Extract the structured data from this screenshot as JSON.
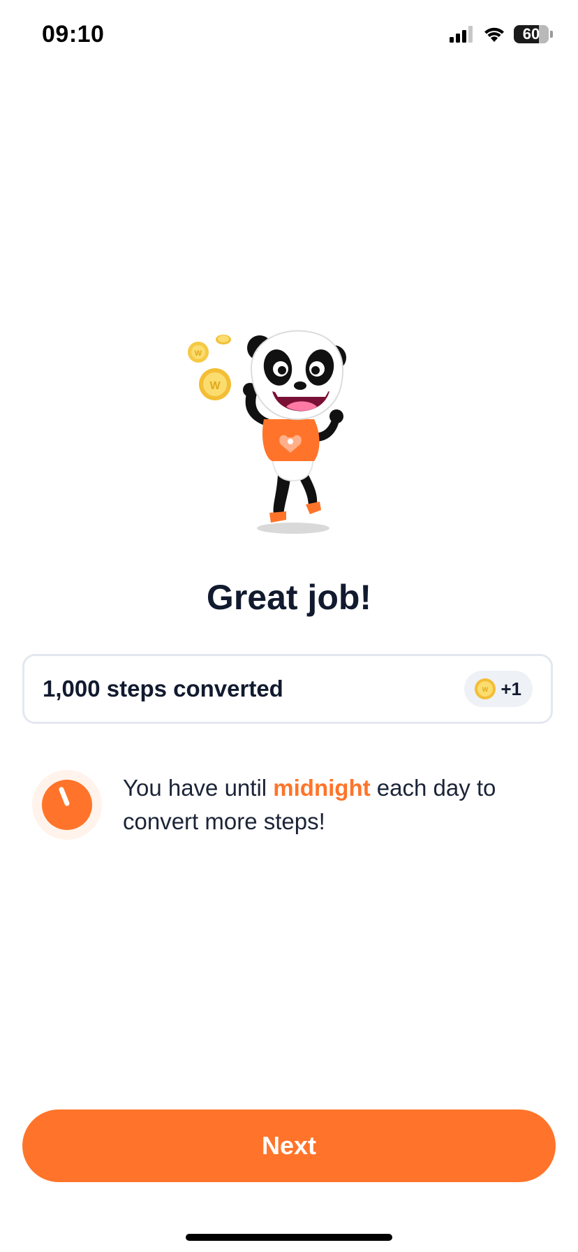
{
  "status_bar": {
    "time": "09:10",
    "battery": "60"
  },
  "main": {
    "title": "Great job!",
    "steps_card": {
      "label": "1,000 steps converted",
      "reward": "+1"
    },
    "reminder": {
      "text_before": "You have until ",
      "highlight": "midnight",
      "text_after": " each day to convert more steps!"
    },
    "next_button": "Next"
  },
  "colors": {
    "accent": "#ff742a",
    "title": "#111a2e",
    "card_border": "#e3e8ef",
    "pill_bg": "#eef1f5"
  },
  "icons": {
    "status": [
      "signal-icon",
      "wifi-icon",
      "battery-icon"
    ],
    "coin": "coin-icon",
    "timer": "timer-icon",
    "mascot": "panda-mascot"
  }
}
